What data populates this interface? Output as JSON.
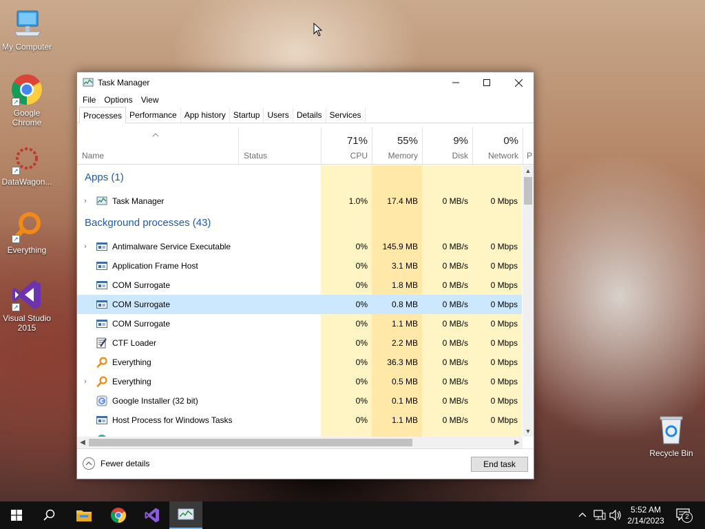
{
  "desktop": {
    "icons": [
      {
        "label": "My Computer"
      },
      {
        "label": "Google Chrome"
      },
      {
        "label": "DataWagon..."
      },
      {
        "label": "Everything"
      },
      {
        "label": "Visual Studio 2015"
      },
      {
        "label": "Recycle Bin"
      }
    ]
  },
  "window": {
    "title": "Task Manager",
    "menu": [
      "File",
      "Options",
      "View"
    ],
    "tabs": [
      "Processes",
      "Performance",
      "App history",
      "Startup",
      "Users",
      "Details",
      "Services"
    ],
    "active_tab": "Processes",
    "columns": {
      "name": "Name",
      "status": "Status",
      "cpu": {
        "label": "CPU",
        "pct": "71%"
      },
      "memory": {
        "label": "Memory",
        "pct": "55%"
      },
      "disk": {
        "label": "Disk",
        "pct": "9%"
      },
      "network": {
        "label": "Network",
        "pct": "0%"
      },
      "power_partial": "P"
    },
    "groups": {
      "apps": "Apps (1)",
      "background": "Background processes (43)"
    },
    "apps": [
      {
        "name": "Task Manager",
        "cpu": "1.0%",
        "memory": "17.4 MB",
        "disk": "0 MB/s",
        "network": "0 Mbps",
        "expandable": true,
        "icon": "task-manager-icon"
      }
    ],
    "background": [
      {
        "name": "Antimalware Service Executable",
        "cpu": "0%",
        "memory": "145.9 MB",
        "disk": "0 MB/s",
        "network": "0 Mbps",
        "expandable": true,
        "icon": "service-window-icon"
      },
      {
        "name": "Application Frame Host",
        "cpu": "0%",
        "memory": "3.1 MB",
        "disk": "0 MB/s",
        "network": "0 Mbps",
        "expandable": false,
        "icon": "service-window-icon"
      },
      {
        "name": "COM Surrogate",
        "cpu": "0%",
        "memory": "1.8 MB",
        "disk": "0 MB/s",
        "network": "0 Mbps",
        "expandable": false,
        "icon": "service-window-icon"
      },
      {
        "name": "COM Surrogate",
        "cpu": "0%",
        "memory": "0.8 MB",
        "disk": "0 MB/s",
        "network": "0 Mbps",
        "expandable": false,
        "icon": "service-window-icon",
        "selected": true
      },
      {
        "name": "COM Surrogate",
        "cpu": "0%",
        "memory": "1.1 MB",
        "disk": "0 MB/s",
        "network": "0 Mbps",
        "expandable": false,
        "icon": "service-window-icon"
      },
      {
        "name": "CTF Loader",
        "cpu": "0%",
        "memory": "2.2 MB",
        "disk": "0 MB/s",
        "network": "0 Mbps",
        "expandable": false,
        "icon": "ctf-loader-icon"
      },
      {
        "name": "Everything",
        "cpu": "0%",
        "memory": "36.3 MB",
        "disk": "0 MB/s",
        "network": "0 Mbps",
        "expandable": false,
        "icon": "everything-search-icon"
      },
      {
        "name": "Everything",
        "cpu": "0%",
        "memory": "0.5 MB",
        "disk": "0 MB/s",
        "network": "0 Mbps",
        "expandable": true,
        "icon": "everything-search-icon"
      },
      {
        "name": "Google Installer (32 bit)",
        "cpu": "0%",
        "memory": "0.1 MB",
        "disk": "0 MB/s",
        "network": "0 Mbps",
        "expandable": false,
        "icon": "google-installer-icon"
      },
      {
        "name": "Host Process for Windows Tasks",
        "cpu": "0%",
        "memory": "1.1 MB",
        "disk": "0 MB/s",
        "network": "0 Mbps",
        "expandable": false,
        "icon": "service-window-icon"
      }
    ],
    "footer": {
      "fewer_details": "Fewer details",
      "end_task": "End task"
    }
  },
  "taskbar": {
    "time": "5:52 AM",
    "date": "2/14/2023",
    "notification_count": "2"
  },
  "colors": {
    "accent_link": "#1e5aa8",
    "cpu_heat": "#fff4c4",
    "memory_heat": "#ffe8a8",
    "selected_row": "#cce8ff"
  }
}
